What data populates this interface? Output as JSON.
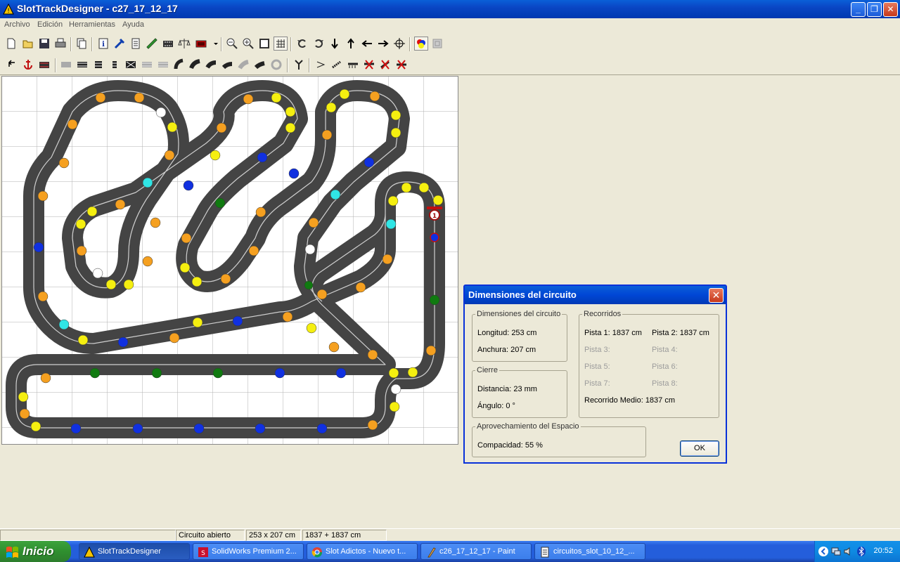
{
  "window": {
    "title": "SlotTrackDesigner - c27_17_12_17"
  },
  "menu": [
    "Archivo",
    "Edición",
    "Herramientas",
    "Ayuda"
  ],
  "toolbar1_icons": [
    "new-icon",
    "open-icon",
    "save-icon",
    "print-icon",
    "copy-icon",
    "info-icon",
    "tools-icon",
    "document-icon",
    "ruler-icon",
    "piece-icon",
    "balance-icon",
    "layer-icon",
    "dropdown-arrow-icon",
    "zoom-out-icon",
    "zoom-in-icon",
    "zoom-fit-icon",
    "grid-icon",
    "rotate-left-icon",
    "rotate-right-icon",
    "arrow-down-icon",
    "arrow-up-icon",
    "arrow-left-icon",
    "arrow-right-icon",
    "center-icon",
    "color-dots-icon",
    "gray-box-icon"
  ],
  "toolbar2_icons": [
    "undo-icon",
    "anchor-icon",
    "track-piece-icon",
    "straight-1-icon",
    "straight-2-icon",
    "straight-3-icon",
    "straight-4-icon",
    "crossing-icon",
    "straight-5-icon",
    "straight-6-icon",
    "curve-1-icon",
    "curve-2-icon",
    "curve-3-icon",
    "curve-4-icon",
    "curve-5-icon",
    "curve-6-icon",
    "curve-7-icon",
    "split-icon",
    "border-1-icon",
    "border-2-icon",
    "border-3-icon",
    "remove-1-icon",
    "remove-2-icon",
    "remove-3-icon"
  ],
  "dialog": {
    "title": "Dimensiones del circuito",
    "dims_group": "Dimensiones del circuito",
    "longitud": "Longitud: 253 cm",
    "anchura": "Anchura: 207 cm",
    "cierre_group": "Cierre",
    "distancia": "Distancia: 23 mm",
    "angulo": "Ángulo: 0 °",
    "recorridos_group": "Recorridos",
    "pista1": "Pista 1: 1837 cm",
    "pista2": "Pista 2: 1837 cm",
    "pista3": "Pista 3:",
    "pista4": "Pista 4:",
    "pista5": "Pista 5:",
    "pista6": "Pista 6:",
    "pista7": "Pista 7:",
    "pista8": "Pista 8:",
    "medio": "Recorrido Medio: 1837 cm",
    "espacio_group": "Aprovechamiento del Espacio",
    "compacidad": "Compacidad: 55 %",
    "ok": "OK"
  },
  "status": {
    "state": "Circuito abierto",
    "size": "253 x 207 cm",
    "lengths": "1837 + 1837 cm"
  },
  "taskbar": {
    "start": "Inicio",
    "tasks": [
      "SlotTrackDesigner",
      "SolidWorks Premium 2...",
      "Slot Adictos - Nuevo t...",
      "c26_17_12_17 - Paint",
      "circuitos_slot_10_12_..."
    ],
    "clock": "20:52"
  },
  "track_markers": {
    "start_label": "1"
  },
  "colors": {
    "track": "#444444",
    "marker_orange": "#f5a020",
    "marker_yellow": "#f5ef10",
    "marker_blue": "#1030e0",
    "marker_green": "#107a10",
    "marker_cyan": "#30e5e5",
    "marker_white": "#ffffff"
  }
}
